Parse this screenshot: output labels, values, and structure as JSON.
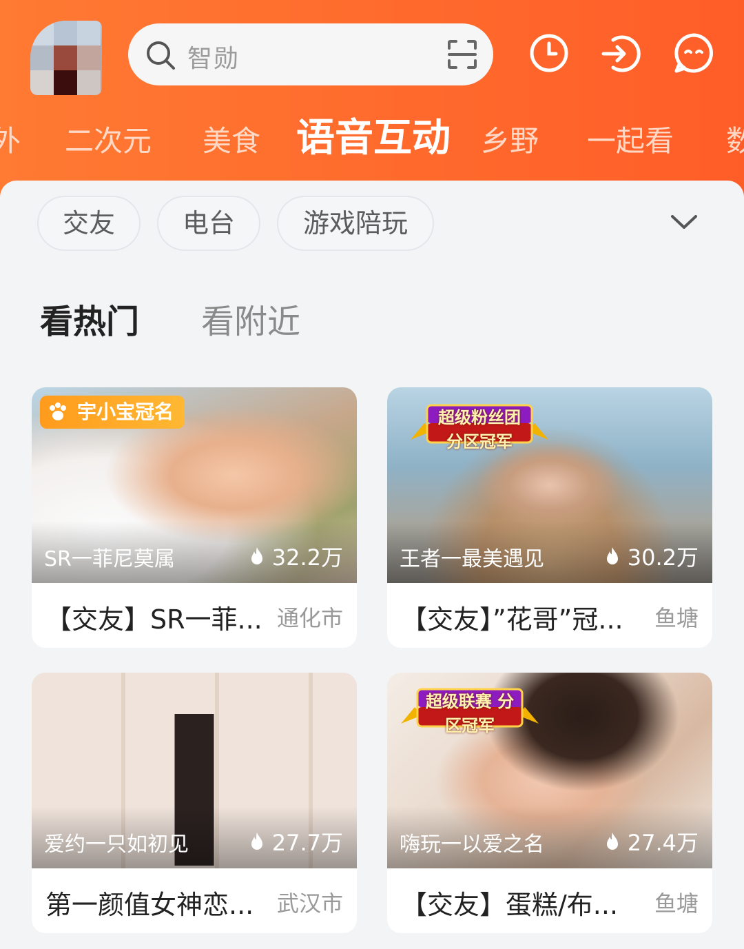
{
  "search": {
    "placeholder": "智勋"
  },
  "tabs": [
    "外",
    "二次元",
    "美食",
    "语音互动",
    "乡野",
    "一起看",
    "数"
  ],
  "active_tab": "语音互动",
  "chips": [
    "交友",
    "电台",
    "游戏陪玩"
  ],
  "subtabs": {
    "hot": "看热门",
    "nearby": "看附近"
  },
  "cards": [
    {
      "badge": "宇小宝冠名",
      "anchor": "SR一菲尼莫属",
      "heat": "32.2万",
      "title": "【交友】SR一菲...",
      "location": "通化市"
    },
    {
      "badge": "超级粉丝团 分区冠军",
      "anchor": "王者一最美遇见",
      "heat": "30.2万",
      "title": "【交友】”花哥”冠...",
      "location": "鱼塘"
    },
    {
      "badge": "",
      "anchor": "爱约一只如初见",
      "heat": "27.7万",
      "title": "第一颜值女神恋...",
      "location": "武汉市"
    },
    {
      "badge": "超级联赛 分区冠军",
      "anchor": "嗨玩一以爱之名",
      "heat": "27.4万",
      "title": "【交友】蛋糕/布...",
      "location": "鱼塘"
    }
  ],
  "colors": {
    "accent": "#ff6a2c",
    "badge_orange": "#ffa826"
  }
}
